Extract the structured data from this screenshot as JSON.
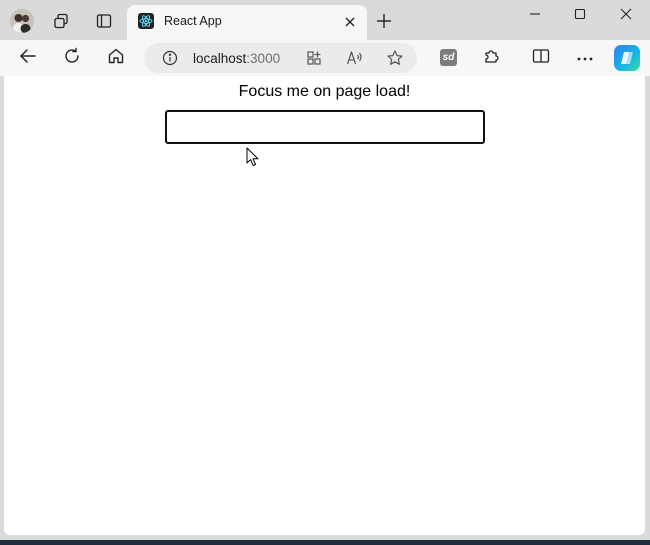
{
  "browser": {
    "tab": {
      "title": "React App"
    },
    "address": {
      "host": "localhost",
      "port": ":3000"
    },
    "extension_badge": "sd"
  },
  "page": {
    "label": "Focus me on page load!",
    "input": {
      "value": "",
      "placeholder": ""
    }
  },
  "colors": {
    "frame": "#dadada",
    "toolbar": "#f7f7f7",
    "address_bg": "#ebebeb",
    "page_bg": "#ffffff",
    "input_border": "#111111"
  },
  "icons": {
    "profile": "profile-avatar-icon",
    "workspaces": "workspaces-icon",
    "tab_actions": "tab-actions-icon",
    "favicon": "react-logo-icon",
    "close_tab": "close-icon",
    "new_tab": "plus-icon",
    "minimize": "minimize-icon",
    "maximize": "maximize-icon",
    "close_window": "close-icon",
    "back": "back-arrow-icon",
    "refresh": "refresh-icon",
    "home": "home-icon",
    "info": "info-icon",
    "apps": "app-available-icon",
    "read_aloud": "read-aloud-icon",
    "favorite": "star-icon",
    "extensions": "puzzle-icon",
    "split_screen": "split-screen-icon",
    "more": "more-icon",
    "copilot": "copilot-icon"
  }
}
